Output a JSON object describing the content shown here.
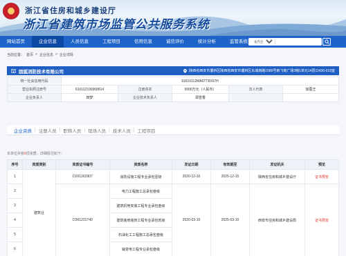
{
  "banner": {
    "title": "浙江省住房和城乡建设厅",
    "subtitle": "浙江省建筑市场监管公共服务系统"
  },
  "nav": {
    "items": [
      "网站首页",
      "企业信息",
      "人员信息",
      "工程项目",
      "信用信息",
      "诚信评价",
      "统计分析",
      "监管系统"
    ],
    "active_index": 1,
    "search": {
      "scope": "省内企业",
      "placeholder": ""
    }
  },
  "breadcrumb": {
    "label": "当前位置：",
    "items": [
      "首页",
      "企业信息",
      "企业详情"
    ],
    "separator": ">"
  },
  "company": {
    "name": "固狐消防技术有限公司",
    "address": "陕西省西安市灞桥区陕西省西安市灞桥区东城南路1589号南飞南广场3幢1单元14层11436-018室"
  },
  "info": {
    "credit_code_label": "统一社会信用代码",
    "credit_code": "91610112MA6TT8X67H",
    "license_label": "营业执照注册号",
    "license": "610112100368814",
    "capital_label": "注册资本",
    "capital": "5000万元（人民币）",
    "legal_label": "法人代表",
    "legal": "徐蓉王",
    "leader_label": "企业负责人",
    "leader": "田梦",
    "tech_label": "企业技术负责人",
    "tech": "郑雪香"
  },
  "tabs": {
    "items": [
      "企业资质",
      "注册人员",
      "职称人员",
      "现场人员",
      "技术人员",
      "工程项目"
    ],
    "active_index": 0,
    "separator": "|"
  },
  "count": {
    "prefix": "本单位共有",
    "value": "6",
    "suffix": "项资质，详细情况如下："
  },
  "qual_table": {
    "headers": [
      "序号",
      "资质类别",
      "资质证书编号",
      "资质名称",
      "发证日期",
      "有效期至",
      "发证机关",
      "预览"
    ],
    "category": "建筑业",
    "rows": [
      {
        "idx": "1",
        "cert": "D261262907",
        "name": "消防设施工程专业承包壹级",
        "issue": "2020-12-16",
        "expire": "2025-12-15",
        "org": "陕西省住房和城乡建设厅",
        "preview": "证书预览"
      },
      {
        "idx": "2",
        "cert": "D361231740",
        "name": "电力工程施工总承包叁级",
        "issue": "2020-03-10",
        "expire": "2025-03-10",
        "org": "西安市住房和城乡建设局",
        "preview": "证书预览"
      },
      {
        "idx": "3",
        "name": "建筑机电安装工程专业承包叁级"
      },
      {
        "idx": "4",
        "name": "建筑装修装饰工程专业承包贰级"
      },
      {
        "idx": "5",
        "name": "石油化工工程施工总承包叁级"
      },
      {
        "idx": "6",
        "name": "输变电工程专业承包叁级"
      }
    ]
  },
  "colors": {
    "nav": "#1f63c9",
    "nav_active": "#0d4aa6",
    "accent_red": "#e0332e",
    "company_bar": "#1f5fc4"
  },
  "icons": [
    "emblem-icon",
    "search-icon",
    "building-icon",
    "location-icon"
  ]
}
